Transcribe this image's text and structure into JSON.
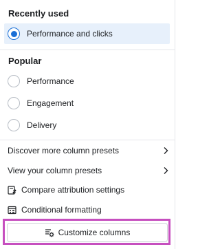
{
  "recently_used": {
    "title": "Recently used",
    "items": [
      {
        "label": "Performance and clicks",
        "selected": true
      }
    ]
  },
  "popular": {
    "title": "Popular",
    "items": [
      {
        "label": "Performance",
        "selected": false
      },
      {
        "label": "Engagement",
        "selected": false
      },
      {
        "label": "Delivery",
        "selected": false
      }
    ]
  },
  "menu": {
    "discover_presets": "Discover more column presets",
    "view_presets": "View your column presets",
    "compare_attribution": "Compare attribution settings",
    "conditional_formatting": "Conditional formatting"
  },
  "customize_button": {
    "label": "Customize columns"
  },
  "icons": {
    "chevron": "chevron-right-icon",
    "compare": "compare-attribution-icon",
    "formatting": "conditional-formatting-icon",
    "customize": "customize-columns-icon"
  },
  "colors": {
    "accent": "#1a6fd6",
    "selected_row_bg": "#e7f0fb",
    "highlight_border": "#c64fbf"
  }
}
